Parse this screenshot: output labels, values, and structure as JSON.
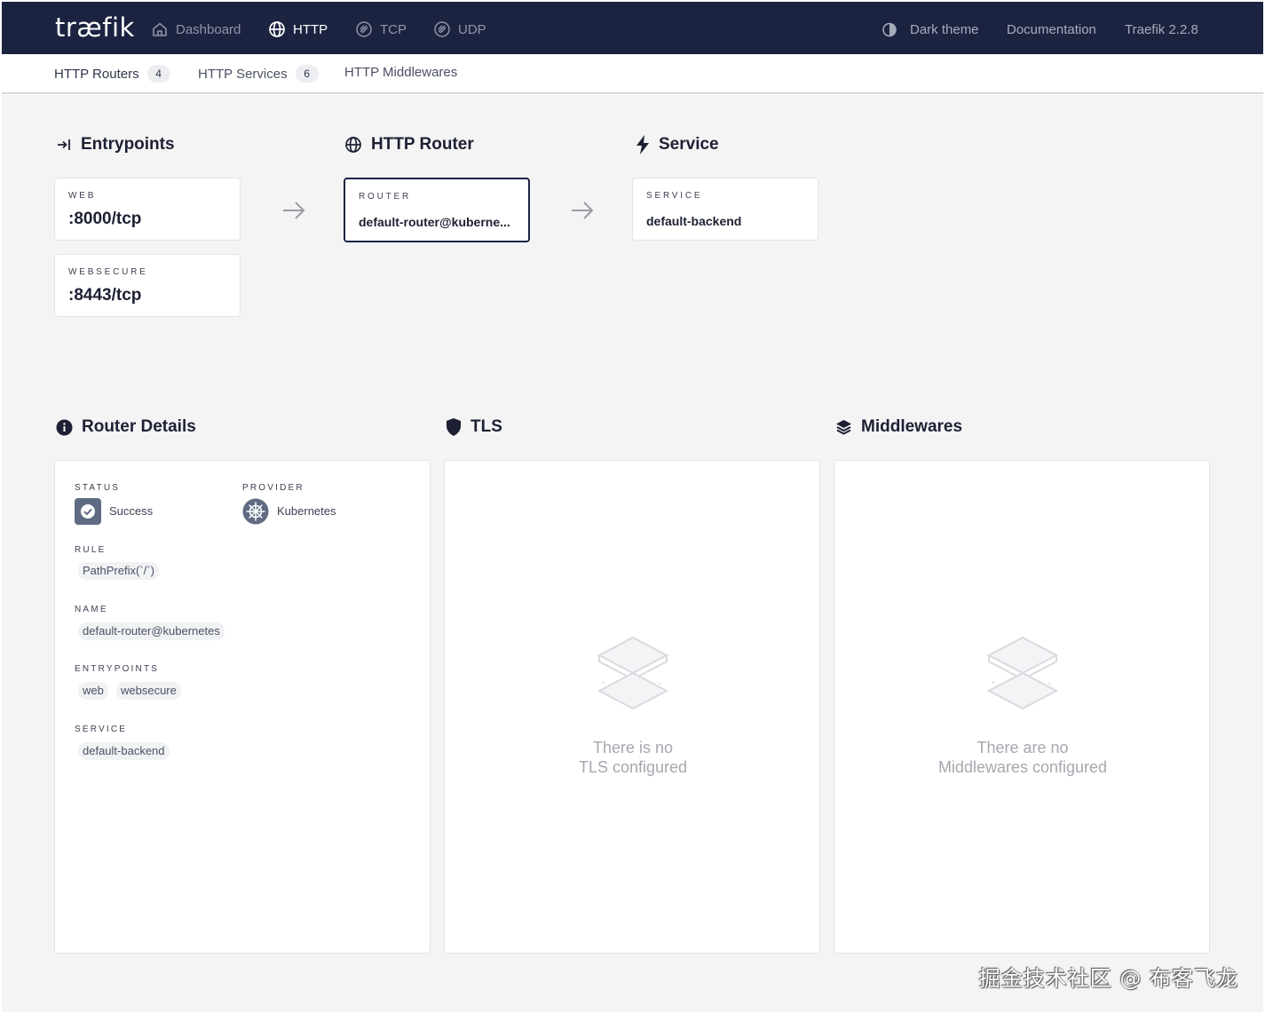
{
  "app": {
    "logo": "træfik"
  },
  "nav": {
    "dashboard": "Dashboard",
    "http": "HTTP",
    "tcp": "TCP",
    "udp": "UDP",
    "dark_theme": "Dark theme",
    "documentation": "Documentation",
    "version": "Traefik 2.2.8"
  },
  "subnav": {
    "routers": {
      "label": "HTTP Routers",
      "count": "4"
    },
    "services": {
      "label": "HTTP Services",
      "count": "6"
    },
    "middlewares": {
      "label": "HTTP Middlewares"
    }
  },
  "flow": {
    "entrypoints_title": "Entrypoints",
    "router_title": "HTTP Router",
    "service_title": "Service",
    "entrypoints": [
      {
        "label": "WEB",
        "value": ":8000/tcp"
      },
      {
        "label": "WEBSECURE",
        "value": ":8443/tcp"
      }
    ],
    "router": {
      "label": "ROUTER",
      "value": "default-router@kuberne..."
    },
    "service": {
      "label": "SERVICE",
      "value": "default-backend"
    }
  },
  "details": {
    "title": "Router Details",
    "status_label": "STATUS",
    "status_value": "Success",
    "provider_label": "PROVIDER",
    "provider_value": "Kubernetes",
    "rule_label": "RULE",
    "rule_value": "PathPrefix(`/`)",
    "name_label": "NAME",
    "name_value": "default-router@kubernetes",
    "entrypoints_label": "ENTRYPOINTS",
    "entrypoints_values": [
      "web",
      "websecure"
    ],
    "service_label": "SERVICE",
    "service_value": "default-backend"
  },
  "tls": {
    "title": "TLS",
    "empty_line1": "There is no",
    "empty_line2": "TLS configured"
  },
  "middlewares": {
    "title": "Middlewares",
    "empty_line1": "There are no",
    "empty_line2": "Middlewares configured"
  },
  "watermark": "掘金技术社区 @ 布客飞龙",
  "colors": {
    "navbar": "#1c2340",
    "background": "#f4f4f5",
    "status": "#5e6b82"
  }
}
